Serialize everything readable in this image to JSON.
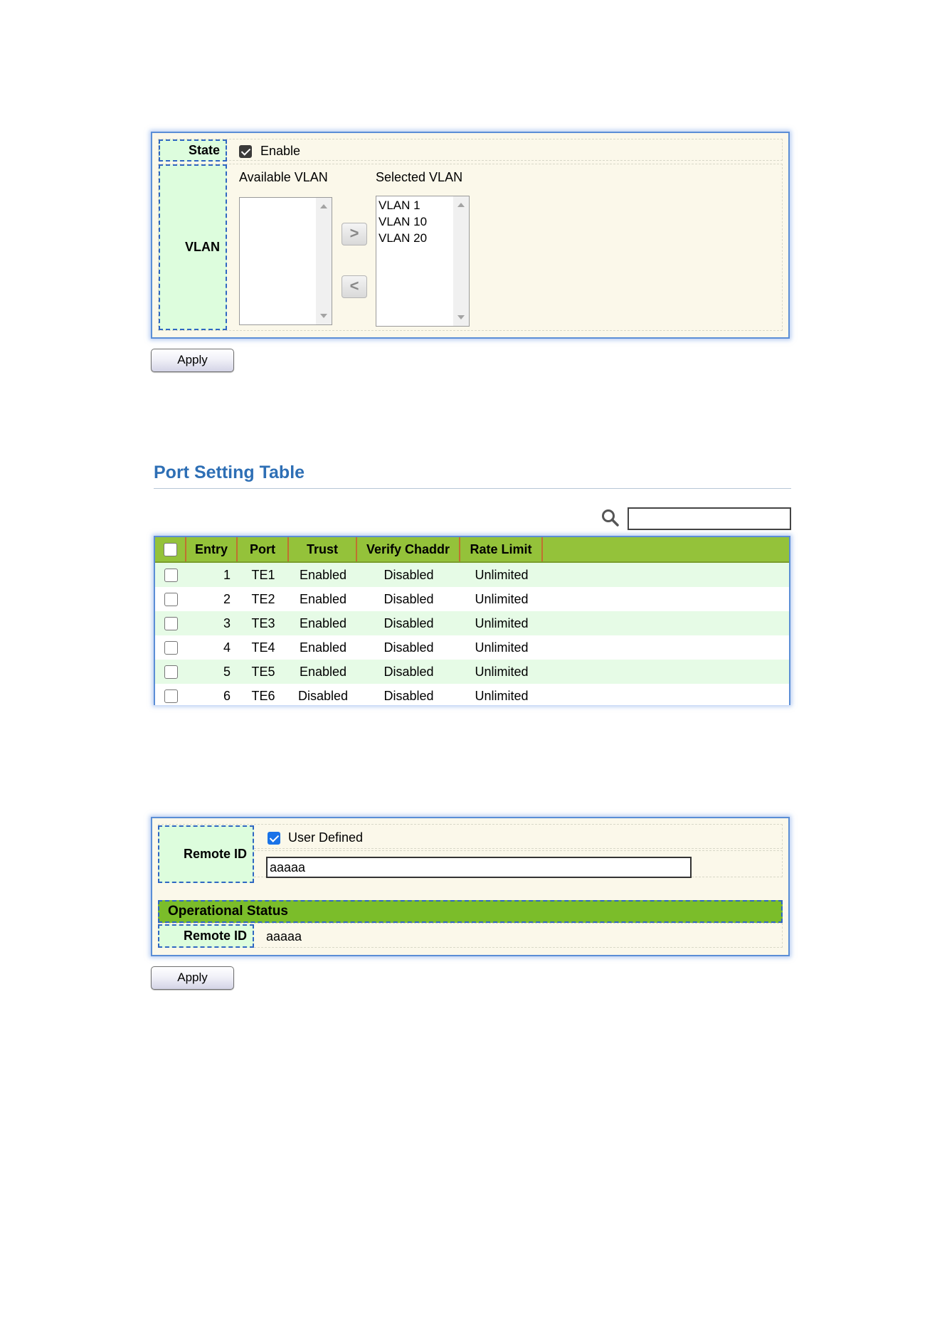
{
  "vlan_form": {
    "state_label": "State",
    "enable_label": "Enable",
    "enable_checked": true,
    "vlan_label": "VLAN",
    "available_title": "Available VLAN",
    "selected_title": "Selected VLAN",
    "available_items": [],
    "selected_items": [
      "VLAN 1",
      "VLAN 10",
      "VLAN 20"
    ],
    "add_symbol": ">",
    "remove_symbol": "<",
    "apply_label": "Apply"
  },
  "port_table": {
    "title": "Port Setting Table",
    "search_icon": "search-icon",
    "search_value": "",
    "columns": [
      "Entry",
      "Port",
      "Trust",
      "Verify Chaddr",
      "Rate Limit"
    ],
    "rows": [
      {
        "entry": "1",
        "port": "TE1",
        "trust": "Enabled",
        "verify": "Disabled",
        "rate": "Unlimited"
      },
      {
        "entry": "2",
        "port": "TE2",
        "trust": "Enabled",
        "verify": "Disabled",
        "rate": "Unlimited"
      },
      {
        "entry": "3",
        "port": "TE3",
        "trust": "Enabled",
        "verify": "Disabled",
        "rate": "Unlimited"
      },
      {
        "entry": "4",
        "port": "TE4",
        "trust": "Enabled",
        "verify": "Disabled",
        "rate": "Unlimited"
      },
      {
        "entry": "5",
        "port": "TE5",
        "trust": "Enabled",
        "verify": "Disabled",
        "rate": "Unlimited"
      },
      {
        "entry": "6",
        "port": "TE6",
        "trust": "Disabled",
        "verify": "Disabled",
        "rate": "Unlimited"
      }
    ],
    "header_color": "#94c23a",
    "odd_row_color": "#e6fbe6"
  },
  "remote_form": {
    "remote_label": "Remote ID",
    "user_defined_label": "User Defined",
    "user_defined_checked": true,
    "remote_value": "aaaaa",
    "op_status_title": "Operational Status",
    "op_remote_label": "Remote ID",
    "op_remote_value": "aaaaa",
    "apply_label": "Apply"
  }
}
